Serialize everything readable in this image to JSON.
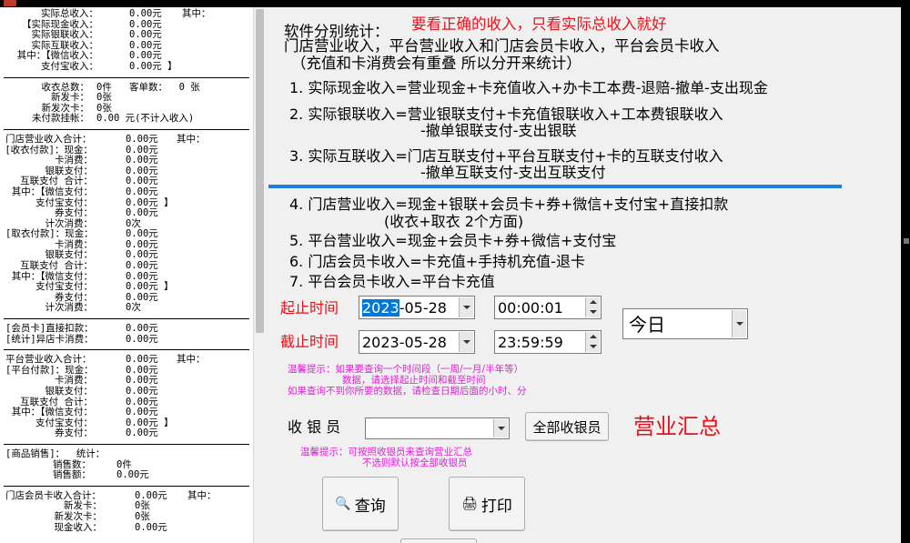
{
  "report": {
    "block1": [
      [
        "实际总收入：",
        "0.00元",
        "其中："
      ],
      [
        "【实际现金收入：",
        "0.00元",
        ""
      ],
      [
        "实际银联收入：",
        "0.00元",
        ""
      ],
      [
        "实际互联收入：",
        "0.00元",
        ""
      ],
      [
        "其中：【微信收入：",
        "0.00元",
        ""
      ],
      [
        "支付宝收入：",
        "0.00元 】",
        ""
      ]
    ],
    "block2": [
      [
        "收衣总数：",
        "0件",
        "客单数：  0 张"
      ],
      [
        "新发卡：",
        "0张",
        ""
      ],
      [
        "新发次卡：",
        "0张",
        ""
      ],
      [
        "未付款挂帐：",
        "0.00 元(不计入收入)",
        ""
      ]
    ],
    "block3": [
      [
        "门店营业收入合计：",
        "0.00元",
        "其中："
      ],
      [
        "[收衣付款]：现金：",
        "0.00元",
        ""
      ],
      [
        "卡消费：",
        "0.00元",
        ""
      ],
      [
        "银联支付：",
        "0.00元",
        ""
      ],
      [
        "互联支付 合计：",
        "0.00元",
        ""
      ],
      [
        "其中：【微信支付：",
        "0.00元",
        ""
      ],
      [
        "支付宝支付：",
        "0.00元 】",
        ""
      ],
      [
        "券支付：",
        "0.00元",
        ""
      ],
      [
        "计次消费：",
        "0次",
        ""
      ],
      [
        "[取衣付款]：现金：",
        "0.00元",
        ""
      ],
      [
        "卡消费：",
        "0.00元",
        ""
      ],
      [
        "银联支付：",
        "0.00元",
        ""
      ],
      [
        "互联支付 合计：",
        "0.00元",
        ""
      ],
      [
        "其中：【微信支付：",
        "0.00元",
        ""
      ],
      [
        "支付宝支付：",
        "0.00元 】",
        ""
      ],
      [
        "券支付：",
        "0.00元",
        ""
      ],
      [
        "计次消费：",
        "0次",
        ""
      ]
    ],
    "block4": [
      [
        "[会员卡]直接扣款：",
        "0.00元",
        ""
      ],
      [
        "[统计]异店卡消费：",
        "0.00元",
        ""
      ]
    ],
    "block5": [
      [
        "平台营业收入合计：",
        "0.00元",
        "其中："
      ],
      [
        "[平台付款]：现金：",
        "0.00元",
        ""
      ],
      [
        "卡消费：",
        "0.00元",
        ""
      ],
      [
        "银联支付：",
        "0.00元",
        ""
      ],
      [
        "互联支付 合计：",
        "0.00元",
        ""
      ],
      [
        "其中：【微信支付：",
        "0.00元",
        ""
      ],
      [
        "支付宝支付：",
        "0.00元 】",
        ""
      ],
      [
        "券支付：",
        "0.00元",
        ""
      ]
    ],
    "block6": [
      [
        "[商品销售]：  统计：",
        "",
        ""
      ],
      [
        "销售数：",
        "0件",
        ""
      ],
      [
        "销售额：",
        "0.00元",
        ""
      ]
    ],
    "block7": [
      [
        "门店会员卡收入合计：",
        "0.00元",
        "其中："
      ],
      [
        "新发卡：",
        "0张",
        ""
      ],
      [
        "新发次卡：",
        "0张",
        ""
      ],
      [
        "现金收入：",
        "0.00元",
        ""
      ]
    ]
  },
  "stats": {
    "heading": "软件分别统计：",
    "notice": "要看正确的收入，只看实际总收入就好",
    "line2": "门店营业收入，平台营业收入和门店会员卡收入，平台会员卡收入",
    "line3": "（充值和卡消费会有重叠 所以分开来统计）",
    "f1": "1. 实际现金收入=营业现金+卡充值收入+办卡工本费-退赔-撤单-支出现金",
    "f2a": "2. 实际银联收入=营业银联支付+卡充值银联收入+工本费银联收入",
    "f2b": "-撤单银联支付-支出银联",
    "f3a": "3. 实际互联收入=门店互联支付+平台互联支付+卡的互联支付收入",
    "f3b": "-撤单互联支付-支出互联支付",
    "f4a": "4. 门店营业收入=现金+银联+会员卡+券+微信+支付宝+直接扣款",
    "f4b": "(收衣+取衣 2个方面)",
    "f5": "5. 平台营业收入=现金+会员卡+券+微信+支付宝",
    "f6": "6. 门店会员卡收入=卡充值+手持机充值-退卡",
    "f7": "7. 平台会员卡收入=平台卡充值"
  },
  "query": {
    "start_label": "起止时间",
    "start_year": "2023",
    "start_date_rest": "-05-28",
    "start_time": "00:00:01",
    "end_label": "截止时间",
    "end_date": "2023-05-28",
    "end_time": "23:59:59",
    "period_value": "今日",
    "tip1": "温馨提示：如果要查询一个时间段（一周/一月/半年等）",
    "tip2": "数据，请选择起止时间和截至时间",
    "tip3": "如果查询不到你所要的数据，请检查日期后面的小时、分",
    "cashier_label": "收 银 员",
    "cashier_value": "",
    "all_cashiers_button": "全部收银员",
    "summary_title": "营业汇总",
    "tip4": "温馨提示：可按照收银员来查询营业汇总",
    "tip5": "不选则默认按全部收银员",
    "search_button": "查询",
    "print_button": "打印"
  },
  "colors": {
    "red": "#e8111a",
    "pink": "#e020d6",
    "accent_blue": "#1f7fdc",
    "selection": "#0078d7"
  },
  "icons": {
    "search": "search-icon",
    "print": "printer-icon"
  }
}
